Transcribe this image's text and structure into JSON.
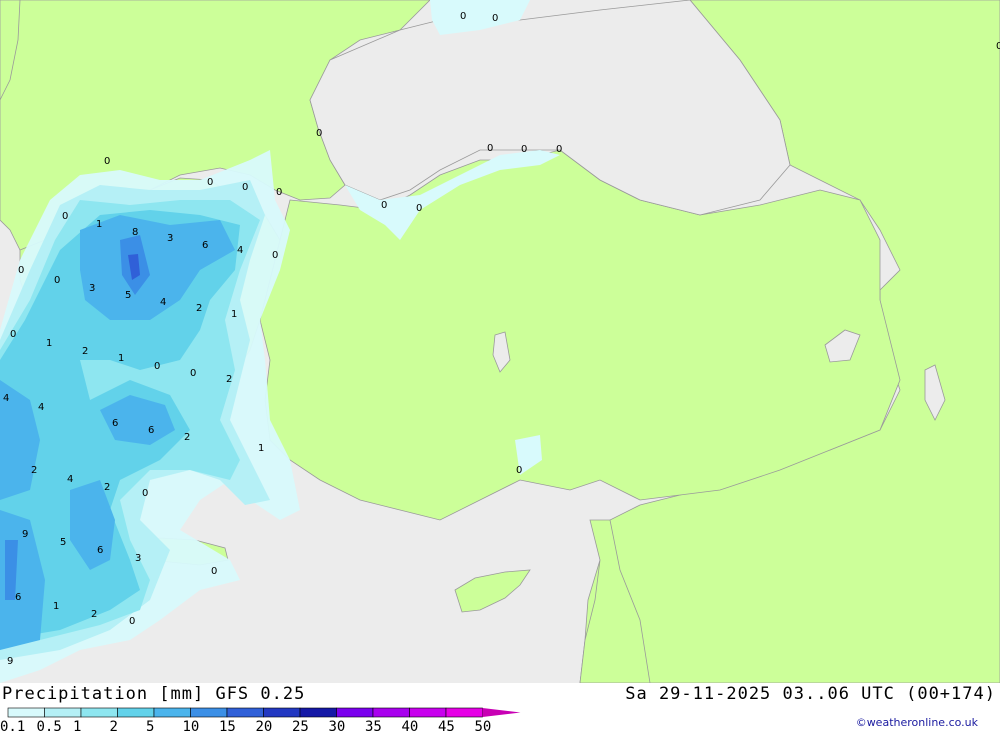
{
  "header": {
    "title": "Precipitation [mm] GFS 0.25",
    "datetime": "Sa 29-11-2025 03..06 UTC (00+174)"
  },
  "credit": "©weatheronline.co.uk",
  "colors": {
    "sea": "#ececec",
    "land": "#ccff99",
    "border": "#9a9a9a",
    "precip_scale": [
      "#d8fafc",
      "#b5f0f6",
      "#8ee6f0",
      "#62d2ea",
      "#4bb4ec",
      "#3b8fe6",
      "#3060d8",
      "#2238c2",
      "#1418a6",
      "#7a00ee",
      "#a800ee",
      "#c800ee",
      "#e600e6",
      "#c800b4",
      "#b000a4"
    ]
  },
  "legend": {
    "ticks": [
      "0.1",
      "0.5",
      "1",
      "2",
      "5",
      "10",
      "15",
      "20",
      "25",
      "30",
      "35",
      "40",
      "45",
      "50"
    ]
  },
  "map_values": [
    "0",
    "0",
    "0",
    "0",
    "0",
    "0",
    "0",
    "0",
    "0",
    "0",
    "0",
    "0",
    "0",
    "0",
    "1",
    "8",
    "3",
    "6",
    "4",
    "0",
    "0",
    "0",
    "3",
    "5",
    "4",
    "2",
    "1",
    "0",
    "1",
    "2",
    "1",
    "0",
    "0",
    "2",
    "4",
    "4",
    "6",
    "6",
    "2",
    "1",
    "2",
    "4",
    "2",
    "0",
    "9",
    "5",
    "6",
    "3",
    "0",
    "6",
    "1",
    "2",
    "0",
    "9",
    "0"
  ]
}
